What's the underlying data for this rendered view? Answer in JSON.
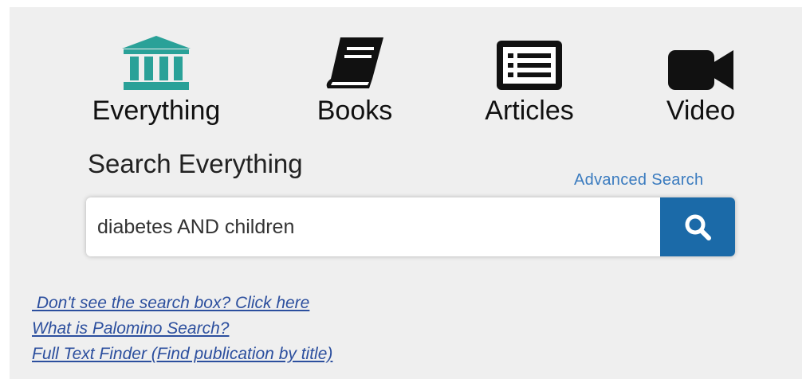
{
  "tabs": [
    {
      "label": "Everything",
      "icon": "library-icon",
      "color": "#2aa198"
    },
    {
      "label": "Books",
      "icon": "book-icon",
      "color": "#111111"
    },
    {
      "label": "Articles",
      "icon": "article-icon",
      "color": "#111111"
    },
    {
      "label": "Video",
      "icon": "video-camera-icon",
      "color": "#111111"
    }
  ],
  "search": {
    "heading": "Search Everything",
    "advanced_label": "Advanced Search",
    "value": "diabetes AND children",
    "button_color": "#1b6aa8"
  },
  "links": [
    " Don't see the search box? Click here",
    "What is Palomino Search?",
    "Full Text Finder (Find publication by title)"
  ]
}
